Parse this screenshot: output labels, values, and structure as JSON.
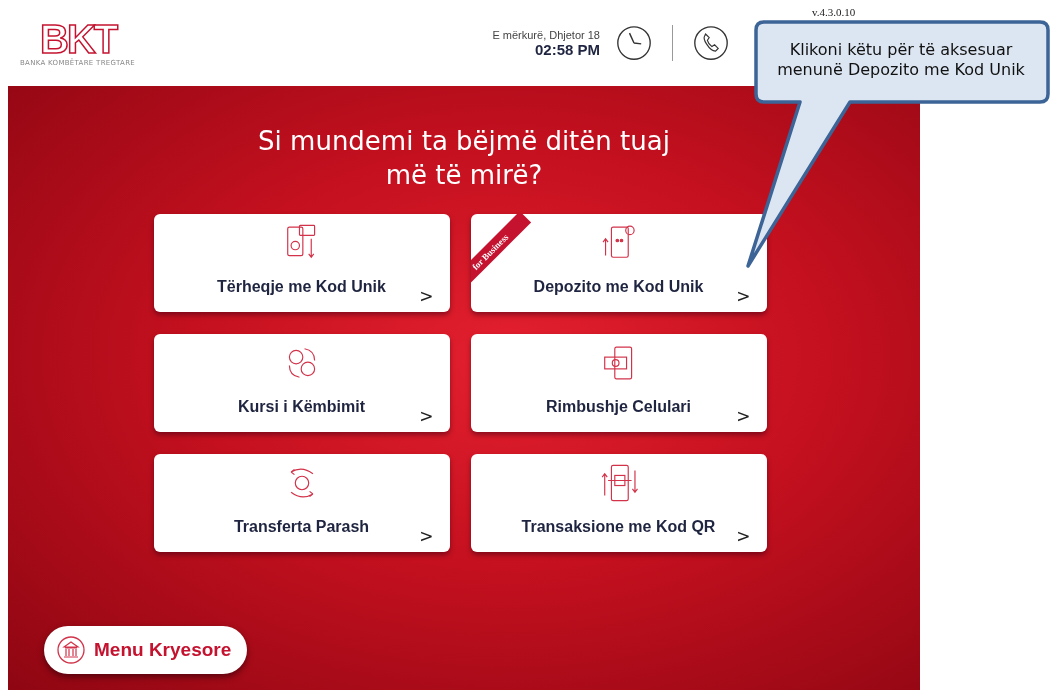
{
  "header": {
    "logo": {
      "letters": "BKT",
      "tagline": "BANKA KOMBËTARE TREGTARE"
    },
    "date": "E mërkurë, Dhjetor 18",
    "time": "02:58 PM",
    "version": "v.4.3.0.10"
  },
  "headline": "Si mundemi ta bëjmë ditën tuaj më të mirë?",
  "services": [
    {
      "label": "Tërheqje me **Kod Unik**",
      "arrow": ">"
    },
    {
      "label": "Depozito me **Kod Unik**",
      "arrow": ">",
      "ribbon": "for Business"
    },
    {
      "label": "Kursi i Këmbimit",
      "arrow": ">"
    },
    {
      "label": "Rimbushje Celulari",
      "arrow": ">"
    },
    {
      "label": "Transferta Parash",
      "arrow": ">"
    },
    {
      "label": "Transaksione me **Kod QR**",
      "arrow": ">"
    }
  ],
  "main_menu_button": {
    "label": "Menu Kryesore"
  },
  "callout": {
    "text": "Klikoni këtu për të aksesuar menunë Depozito me Kod Unik"
  }
}
